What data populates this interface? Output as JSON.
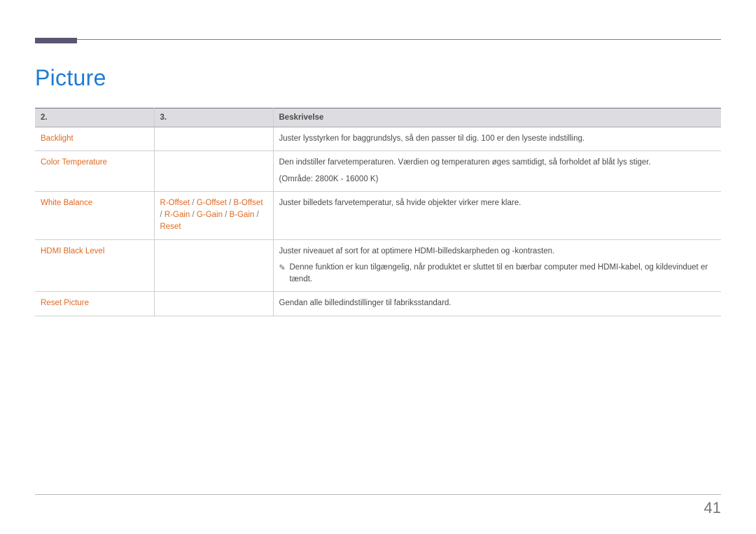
{
  "title": "Picture",
  "pageNumber": "41",
  "headers": {
    "col1": "2.",
    "col2": "3.",
    "col3": "Beskrivelse"
  },
  "rows": {
    "backlight": {
      "label": "Backlight",
      "desc": "Juster lysstyrken for baggrundslys, så den passer til dig. 100 er den lyseste indstilling."
    },
    "colorTemp": {
      "label": "Color Temperature",
      "desc1": "Den indstiller farvetemperaturen. Værdien og temperaturen øges samtidigt, så forholdet af blåt lys stiger.",
      "desc2": "(Område: 2800K - 16000 K)"
    },
    "whiteBalance": {
      "label": "White Balance",
      "opts": {
        "rOffset": "R-Offset",
        "gOffset": "G-Offset",
        "bOffset": "B-Offset",
        "rGain": "R-Gain",
        "gGain": "G-Gain",
        "bGain": "B-Gain",
        "reset": "Reset"
      },
      "desc": "Juster billedets farvetemperatur, så hvide objekter virker mere klare."
    },
    "hdmi": {
      "label": "HDMI Black Level",
      "desc": "Juster niveauet af sort for at optimere HDMI-billedskarpheden og -kontrasten.",
      "note": "Denne funktion er kun tilgængelig, når produktet er sluttet til en bærbar computer med HDMI-kabel, og kildevinduet er tændt."
    },
    "resetPic": {
      "label": "Reset Picture",
      "desc": "Gendan alle billedindstillinger til fabriksstandard."
    }
  }
}
